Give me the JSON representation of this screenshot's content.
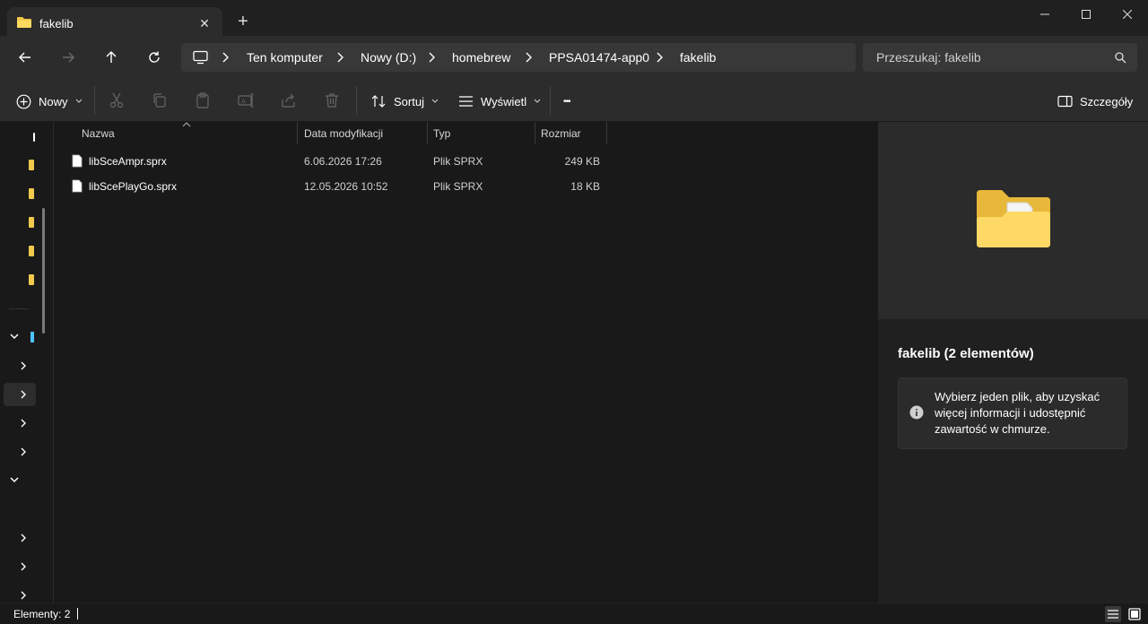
{
  "window": {
    "tab_title": "fakelib",
    "tab_close_glyph": "✕",
    "new_tab_glyph": "+"
  },
  "breadcrumb": {
    "items": [
      "Ten komputer",
      "Nowy (D:)",
      "homebrew",
      "PPSA01474-app0",
      "fakelib"
    ]
  },
  "search": {
    "placeholder": "Przeszukaj: fakelib"
  },
  "toolbar": {
    "new_label": "Nowy",
    "sort_label": "Sortuj",
    "view_label": "Wyświetl",
    "more_glyph": "•••",
    "details_label": "Szczegóły"
  },
  "columns": {
    "name": "Nazwa",
    "modified": "Data modyfikacji",
    "type": "Typ",
    "size": "Rozmiar"
  },
  "files": [
    {
      "name": "libSceAmpr.sprx",
      "modified": "6.06.2026 17:26",
      "type": "Plik SPRX",
      "size": "249 KB"
    },
    {
      "name": "libScePlayGo.sprx",
      "modified": "12.05.2026 10:52",
      "type": "Plik SPRX",
      "size": "18 KB"
    }
  ],
  "details": {
    "title": "fakelib (2 elementów)",
    "info": "Wybierz jeden plik, aby uzyskać więcej informacji i udostępnić zawartość w chmurze."
  },
  "status": {
    "count": "Elementy: 2"
  },
  "colors": {
    "folder": "#f2c94c",
    "accent": "#4cc2ff"
  }
}
